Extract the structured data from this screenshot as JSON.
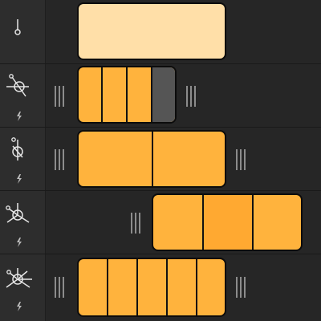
{
  "colors": {
    "background": "#262626",
    "sidebar": "#2d2d2d",
    "clip_active": "#ffb33d",
    "clip_pale": "#ffdfa8",
    "clip_selected_segment": "#ffa931",
    "clip_disabled_segment": "#555555",
    "handle": "#8c8c8c"
  },
  "tracks": [
    {
      "icon": "single-node-icon",
      "has_bolt": false,
      "clip": {
        "style": "pale",
        "segments": 1,
        "disabled_segments": [],
        "selected_segments": []
      },
      "handles": {
        "left": false,
        "right": false
      }
    },
    {
      "icon": "circle-slash-node-icon",
      "has_bolt": true,
      "clip": {
        "style": "active",
        "segments": 4,
        "disabled_segments": [
          3
        ],
        "selected_segments": []
      },
      "handles": {
        "left": true,
        "right": true
      }
    },
    {
      "icon": "circle-node-icon",
      "has_bolt": true,
      "clip": {
        "style": "active",
        "segments": 2,
        "disabled_segments": [],
        "selected_segments": []
      },
      "handles": {
        "left": true,
        "right": true
      }
    },
    {
      "icon": "tri-branch-node-icon",
      "has_bolt": true,
      "clip": {
        "style": "active",
        "segments": 3,
        "disabled_segments": [],
        "selected_segments": [
          1
        ]
      },
      "handles": {
        "left": true,
        "right": false
      }
    },
    {
      "icon": "multi-branch-node-icon",
      "has_bolt": true,
      "clip": {
        "style": "active",
        "segments": 5,
        "disabled_segments": [],
        "selected_segments": []
      },
      "handles": {
        "left": true,
        "right": true
      }
    }
  ]
}
